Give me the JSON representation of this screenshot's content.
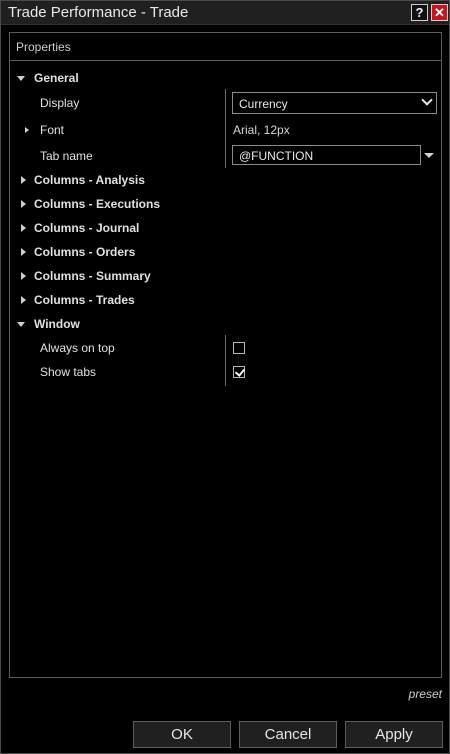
{
  "window": {
    "title": "Trade Performance - Trade",
    "help_glyph": "?",
    "close_glyph": "✕"
  },
  "panel": {
    "header": "Properties"
  },
  "general": {
    "label": "General",
    "display": {
      "label": "Display",
      "value": "Currency"
    },
    "font": {
      "label": "Font",
      "value": "Arial, 12px"
    },
    "tab_name": {
      "label": "Tab name",
      "value": "@FUNCTION"
    }
  },
  "categories": [
    "Columns - Analysis",
    "Columns - Executions",
    "Columns - Journal",
    "Columns - Orders",
    "Columns - Summary",
    "Columns - Trades"
  ],
  "window_section": {
    "label": "Window",
    "always_on_top": {
      "label": "Always on top",
      "checked": false
    },
    "show_tabs": {
      "label": "Show tabs",
      "checked": true
    }
  },
  "footer": {
    "preset": "preset",
    "ok": "OK",
    "cancel": "Cancel",
    "apply": "Apply"
  }
}
